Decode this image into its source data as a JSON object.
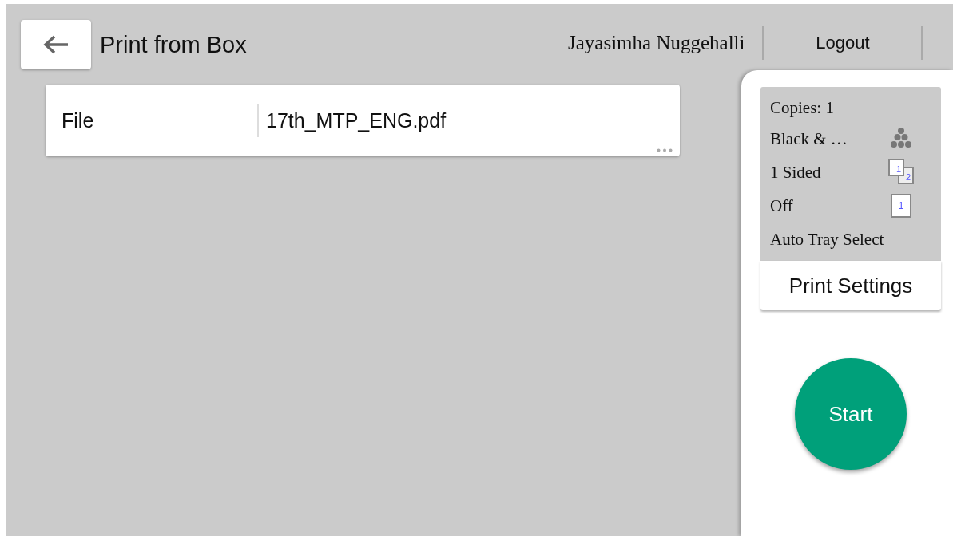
{
  "header": {
    "title": "Print from Box",
    "user": "Jayasimha Nuggehalli",
    "logout": "Logout"
  },
  "file_row": {
    "label": "File",
    "value": "17th_MTP_ENG.pdf"
  },
  "settings_summary": [
    {
      "text": "Copies: 1",
      "kind": "plain"
    },
    {
      "text": "Black & …",
      "kind": "color"
    },
    {
      "text": "1 Sided",
      "kind": "sides",
      "icon_text": [
        "1",
        "2"
      ]
    },
    {
      "text": "Off",
      "kind": "page",
      "icon_text": [
        "1"
      ]
    },
    {
      "text": "Auto Tray Select",
      "kind": "plain"
    }
  ],
  "print_settings_button": "Print Settings",
  "start_button": "Start"
}
